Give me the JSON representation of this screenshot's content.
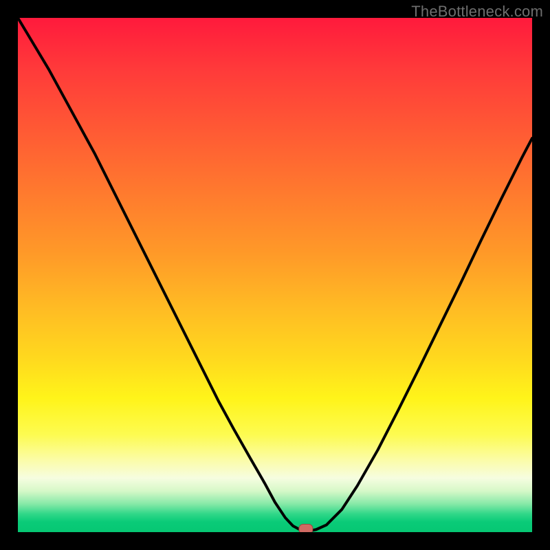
{
  "watermark": "TheBottleneck.com",
  "chart_data": {
    "type": "line",
    "title": "",
    "xlabel": "",
    "ylabel": "",
    "xlim": [
      0,
      100
    ],
    "ylim": [
      0,
      100
    ],
    "x": [
      0,
      3,
      6,
      9,
      12,
      15,
      18,
      21,
      24,
      27,
      30,
      33,
      36,
      39,
      42,
      45,
      48,
      50,
      52,
      53.5,
      55,
      56.5,
      58,
      60,
      63,
      66,
      70,
      74,
      78,
      82,
      86,
      90,
      94,
      98,
      100
    ],
    "values": [
      100,
      95,
      90,
      84.5,
      79,
      73.5,
      67.5,
      61.5,
      55.5,
      49.5,
      43.5,
      37.5,
      31.5,
      25.5,
      20,
      14.7,
      9.5,
      5.8,
      2.8,
      1.2,
      0.4,
      0.2,
      0.5,
      1.4,
      4.4,
      9.0,
      16.0,
      23.8,
      31.8,
      40.0,
      48.2,
      56.6,
      64.8,
      72.8,
      76.6
    ],
    "marker": {
      "x": 56,
      "y": 0.6
    },
    "grid": false,
    "legend": false
  },
  "colors": {
    "curve": "#000000",
    "marker_fill": "#d06a63",
    "marker_stroke": "#9b4640"
  }
}
